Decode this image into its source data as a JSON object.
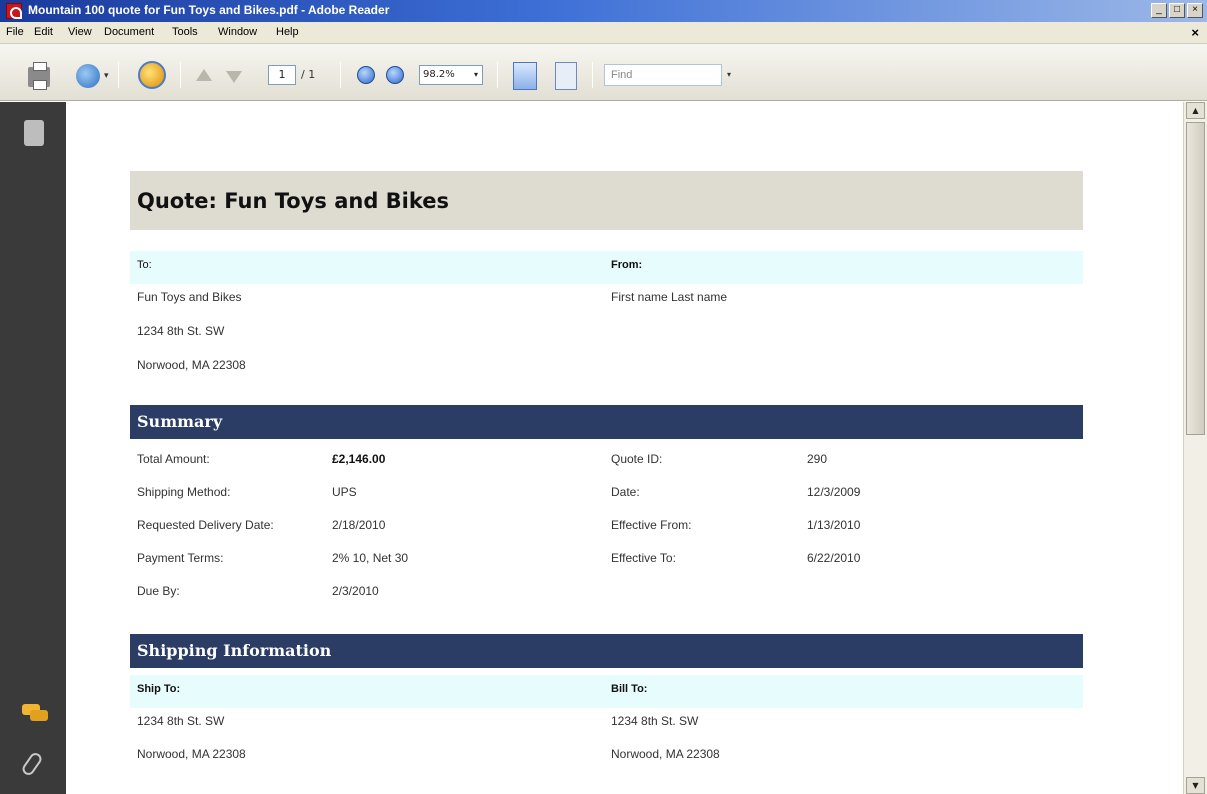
{
  "window": {
    "title": "Mountain 100 quote for Fun Toys and Bikes.pdf - Adobe Reader",
    "buttons": {
      "minimize": "_",
      "maximize": "□",
      "close": "×"
    }
  },
  "menu": {
    "items": [
      "File",
      "Edit",
      "View",
      "Document",
      "Tools",
      "Window",
      "Help"
    ],
    "close": "×"
  },
  "toolbar": {
    "page_current": "1",
    "page_total": "/ 1",
    "zoom": "98.2%",
    "find_placeholder": "Find",
    "dropdown_arrow": "▾"
  },
  "scrollbar": {
    "up": "▲",
    "down": "▼"
  },
  "document": {
    "title": "Quote: Fun Toys and Bikes",
    "to_label": "To:",
    "from_label": "From:",
    "to_lines": [
      "Fun Toys and Bikes",
      "1234 8th St. SW",
      "Norwood, MA 22308"
    ],
    "from_name": "First name Last name",
    "summary": {
      "heading": "Summary",
      "rows_left": [
        {
          "label": "Total Amount:",
          "value": "£2,146.00"
        },
        {
          "label": "Shipping Method:",
          "value": "UPS"
        },
        {
          "label": "Requested Delivery Date:",
          "value": "2/18/2010"
        },
        {
          "label": "Payment Terms:",
          "value": "2% 10, Net 30"
        },
        {
          "label": "Due By:",
          "value": "2/3/2010"
        }
      ],
      "rows_right": [
        {
          "label": "Quote ID:",
          "value": "290"
        },
        {
          "label": "Date:",
          "value": "12/3/2009"
        },
        {
          "label": "Effective From:",
          "value": "1/13/2010"
        },
        {
          "label": "Effective To:",
          "value": "6/22/2010"
        }
      ]
    },
    "shipping": {
      "heading": "Shipping Information",
      "ship_to_label": "Ship To:",
      "bill_to_label": "Bill To:",
      "ship_to_lines": [
        "1234 8th St. SW",
        "Norwood, MA 22308"
      ],
      "bill_to_lines": [
        "1234 8th St. SW",
        "Norwood, MA 22308"
      ]
    }
  }
}
